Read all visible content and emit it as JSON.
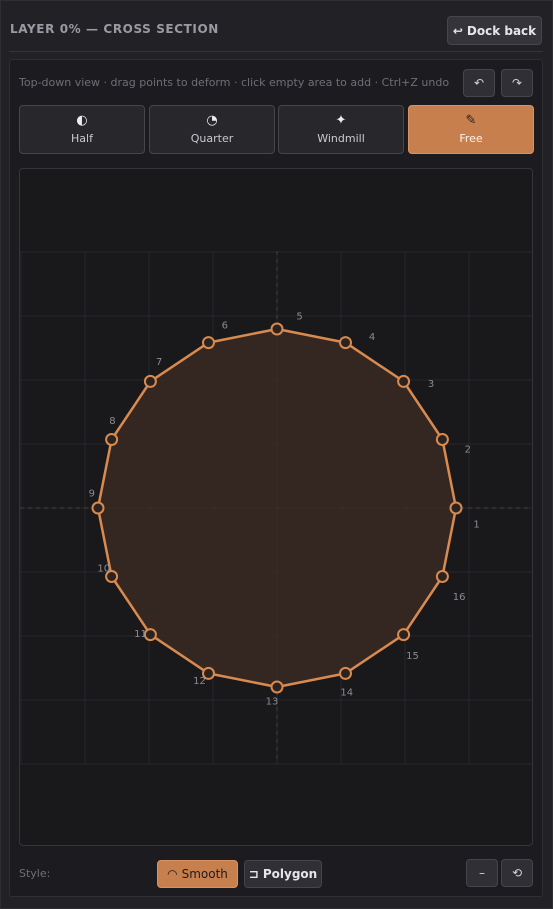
{
  "header": {
    "title": "LAYER 0% — CROSS SECTION",
    "dock_icon": "return-arrow-icon",
    "dock_label": "Dock back"
  },
  "toolbar": {
    "hint": "Top-down view · drag points to deform · click empty area to add · Ctrl+Z undo",
    "undo_glyph": "↶",
    "redo_glyph": "↷"
  },
  "presets": [
    {
      "label": "Half",
      "glyph": "◐",
      "icon": "half-circle-icon",
      "active": false
    },
    {
      "label": "Quarter",
      "glyph": "◔",
      "icon": "quarter-circle-icon",
      "active": false
    },
    {
      "label": "Windmill",
      "glyph": "✦",
      "icon": "windmill-star-icon",
      "active": false
    },
    {
      "label": "Free",
      "glyph": "✎",
      "icon": "pencil-icon",
      "active": true
    }
  ],
  "editor": {
    "point_labels": [
      "1",
      "2",
      "3",
      "4",
      "5",
      "6",
      "7",
      "8",
      "9",
      "10",
      "11",
      "12",
      "13",
      "14",
      "15",
      "16"
    ],
    "shape_points": 16,
    "accent_color": "#d88a4f",
    "fill_color": "#3a2a22"
  },
  "footer": {
    "style_label": "Style:",
    "smooth_glyph": "◠",
    "smooth_label": "Smooth",
    "polygon_glyph": "⊐",
    "polygon_label": "Polygon",
    "minus_glyph": "–",
    "reset_glyph": "⟲"
  }
}
